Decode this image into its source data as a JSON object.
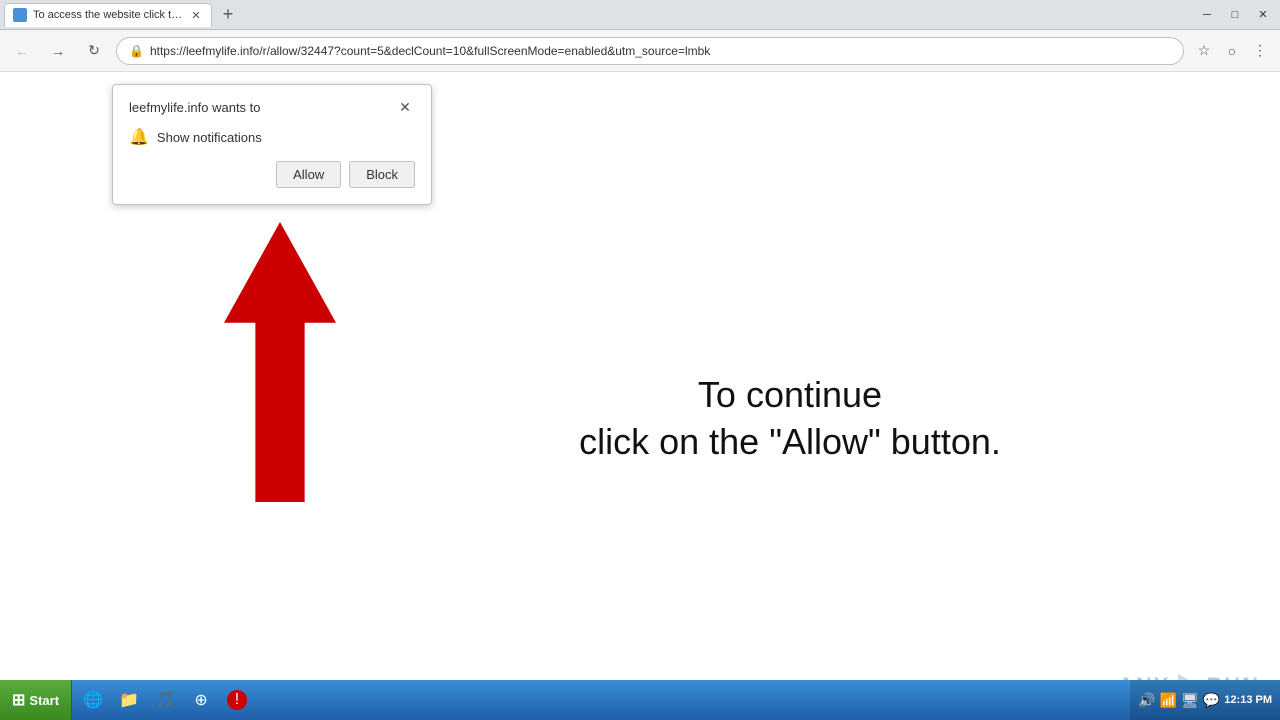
{
  "titlebar": {
    "tab": {
      "title": "To access the website click the \"Allo...",
      "favicon": "tab-favicon"
    },
    "new_tab_label": "+",
    "controls": {
      "minimize": "─",
      "maximize": "□",
      "close": "✕"
    }
  },
  "addressbar": {
    "back_label": "←",
    "forward_label": "→",
    "refresh_label": "↻",
    "url": "https://leefmylife.info/r/allow/32447?count=5&declCount=10&fullScreenMode=enabled&utm_source=lmbk",
    "bookmark_icon": "☆",
    "profile_icon": "○",
    "menu_icon": "⋮"
  },
  "popup": {
    "title": "leefmylife.info wants to",
    "close_label": "✕",
    "notification_text": "Show notifications",
    "allow_label": "Allow",
    "block_label": "Block"
  },
  "page": {
    "instruction_line1": "To continue",
    "instruction_line2": "click on the \"Allow\" button."
  },
  "taskbar": {
    "start_label": "Start",
    "time": "12:13 PM",
    "apps": [
      {
        "name": "ie",
        "icon": "🌐"
      },
      {
        "name": "explorer",
        "icon": "📁"
      },
      {
        "name": "wmp",
        "icon": "🎵"
      },
      {
        "name": "chrome",
        "icon": "⊕"
      },
      {
        "name": "security",
        "icon": "🛡"
      }
    ]
  }
}
